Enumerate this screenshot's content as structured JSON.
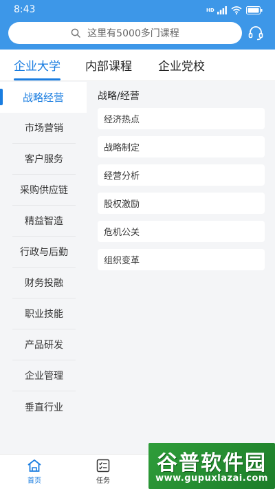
{
  "colors": {
    "header": "#3d97e8",
    "accent": "#1a7de0",
    "background": "#f4f5f7",
    "watermark": "#2f9d3a"
  },
  "status_bar": {
    "time": "8:43",
    "network_badge": "HD",
    "icons": [
      "signal-icon",
      "wifi-icon",
      "battery-icon"
    ]
  },
  "search": {
    "placeholder": "这里有5000多门课程",
    "icon": "search-icon",
    "support_icon": "headset-icon"
  },
  "tabs": [
    {
      "label": "企业大学",
      "active": true
    },
    {
      "label": "内部课程",
      "active": false
    },
    {
      "label": "企业党校",
      "active": false
    }
  ],
  "sidebar": {
    "items": [
      {
        "label": "战略经营",
        "active": true
      },
      {
        "label": "市场营销"
      },
      {
        "label": "客户服务"
      },
      {
        "label": "采购供应链"
      },
      {
        "label": "精益智造"
      },
      {
        "label": "行政与后勤"
      },
      {
        "label": "财务投融"
      },
      {
        "label": "职业技能"
      },
      {
        "label": "产品研发"
      },
      {
        "label": "企业管理"
      },
      {
        "label": "垂直行业"
      }
    ]
  },
  "content": {
    "title": "战略/经营",
    "courses": [
      "经济热点",
      "战略制定",
      "经营分析",
      "股权激励",
      "危机公关",
      "组织变革"
    ]
  },
  "bottom_nav": [
    {
      "label": "首页",
      "icon": "home-icon",
      "active": true
    },
    {
      "label": "任务",
      "icon": "task-icon",
      "active": false
    }
  ],
  "watermark": {
    "brand": "谷普软件园",
    "url": "www.gupuxlazai.com"
  }
}
